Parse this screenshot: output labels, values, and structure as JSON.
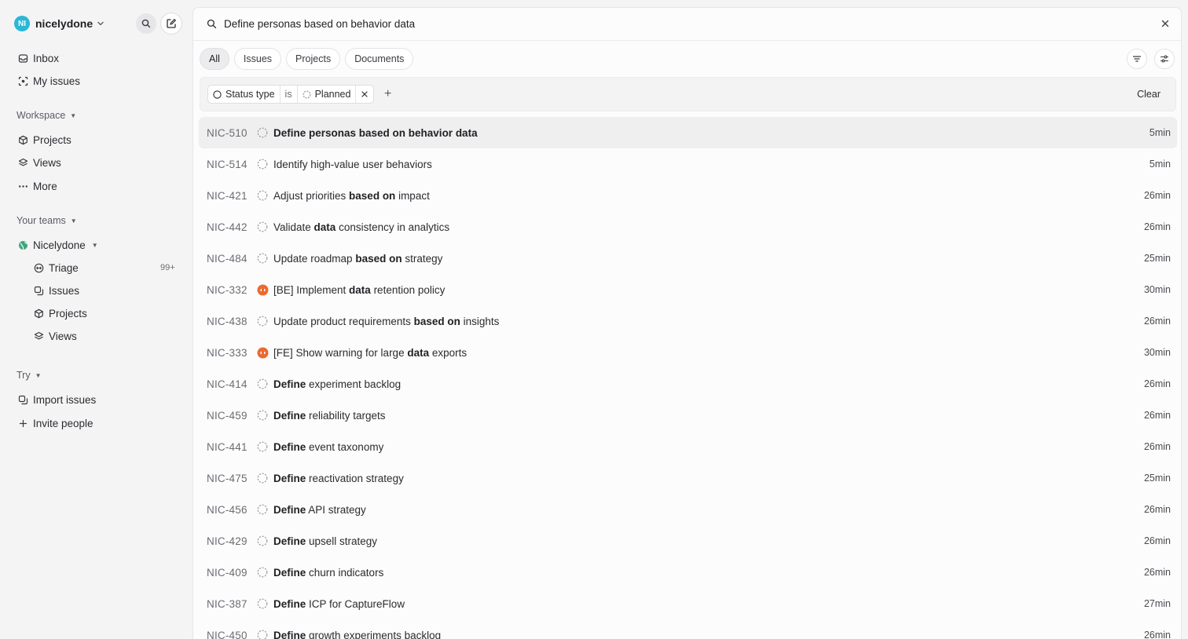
{
  "workspace": {
    "initials": "NI",
    "name": "nicelydone",
    "avatar_color": "#2ab7d6"
  },
  "nav": {
    "inbox": "Inbox",
    "my_issues": "My issues",
    "workspace_label": "Workspace",
    "projects": "Projects",
    "views": "Views",
    "more": "More",
    "teams_label": "Your teams",
    "team_name": "Nicelydone",
    "triage": "Triage",
    "triage_badge": "99+",
    "team_issues": "Issues",
    "team_projects": "Projects",
    "team_views": "Views",
    "try_label": "Try",
    "import_issues": "Import issues",
    "invite_people": "Invite people"
  },
  "search": {
    "query": "Define personas based on behavior data"
  },
  "tabs": [
    "All",
    "Issues",
    "Projects",
    "Documents"
  ],
  "filter": {
    "field": "Status type",
    "operator": "is",
    "value": "Planned",
    "clear_label": "Clear"
  },
  "colors": {
    "urgent": "#eb6a32",
    "status_gray": "#9a9ba1"
  },
  "results": [
    {
      "id": "NIC-510",
      "status": "planned",
      "time": "5min",
      "segments": [
        [
          "Define personas based on behavior data",
          true
        ]
      ]
    },
    {
      "id": "NIC-514",
      "status": "planned",
      "time": "5min",
      "segments": [
        [
          "Identify high-value user behaviors",
          false
        ]
      ]
    },
    {
      "id": "NIC-421",
      "status": "planned",
      "time": "26min",
      "segments": [
        [
          "Adjust priorities ",
          false
        ],
        [
          "based on",
          true
        ],
        [
          " impact",
          false
        ]
      ]
    },
    {
      "id": "NIC-442",
      "status": "planned",
      "time": "26min",
      "segments": [
        [
          "Validate ",
          false
        ],
        [
          "data",
          true
        ],
        [
          " consistency in analytics",
          false
        ]
      ]
    },
    {
      "id": "NIC-484",
      "status": "planned",
      "time": "25min",
      "segments": [
        [
          "Update roadmap ",
          false
        ],
        [
          "based on",
          true
        ],
        [
          " strategy",
          false
        ]
      ]
    },
    {
      "id": "NIC-332",
      "status": "urgent",
      "time": "30min",
      "segments": [
        [
          "[BE] Implement ",
          false
        ],
        [
          "data",
          true
        ],
        [
          " retention policy",
          false
        ]
      ]
    },
    {
      "id": "NIC-438",
      "status": "planned",
      "time": "26min",
      "segments": [
        [
          "Update product requirements ",
          false
        ],
        [
          "based on",
          true
        ],
        [
          " insights",
          false
        ]
      ]
    },
    {
      "id": "NIC-333",
      "status": "urgent",
      "time": "30min",
      "segments": [
        [
          "[FE] Show warning for large ",
          false
        ],
        [
          "data",
          true
        ],
        [
          " exports",
          false
        ]
      ]
    },
    {
      "id": "NIC-414",
      "status": "planned",
      "time": "26min",
      "segments": [
        [
          "Define",
          true
        ],
        [
          " experiment backlog",
          false
        ]
      ]
    },
    {
      "id": "NIC-459",
      "status": "planned",
      "time": "26min",
      "segments": [
        [
          "Define",
          true
        ],
        [
          " reliability targets",
          false
        ]
      ]
    },
    {
      "id": "NIC-441",
      "status": "planned",
      "time": "26min",
      "segments": [
        [
          "Define",
          true
        ],
        [
          " event taxonomy",
          false
        ]
      ]
    },
    {
      "id": "NIC-475",
      "status": "planned",
      "time": "25min",
      "segments": [
        [
          "Define",
          true
        ],
        [
          " reactivation strategy",
          false
        ]
      ]
    },
    {
      "id": "NIC-456",
      "status": "planned",
      "time": "26min",
      "segments": [
        [
          "Define",
          true
        ],
        [
          " API strategy",
          false
        ]
      ]
    },
    {
      "id": "NIC-429",
      "status": "planned",
      "time": "26min",
      "segments": [
        [
          "Define",
          true
        ],
        [
          " upsell strategy",
          false
        ]
      ]
    },
    {
      "id": "NIC-409",
      "status": "planned",
      "time": "26min",
      "segments": [
        [
          "Define",
          true
        ],
        [
          " churn indicators",
          false
        ]
      ]
    },
    {
      "id": "NIC-387",
      "status": "planned",
      "time": "27min",
      "segments": [
        [
          "Define",
          true
        ],
        [
          " ICP for CaptureFlow",
          false
        ]
      ]
    },
    {
      "id": "NIC-450",
      "status": "planned",
      "time": "26min",
      "segments": [
        [
          "Define",
          true
        ],
        [
          " growth experiments backlog",
          false
        ]
      ]
    }
  ]
}
